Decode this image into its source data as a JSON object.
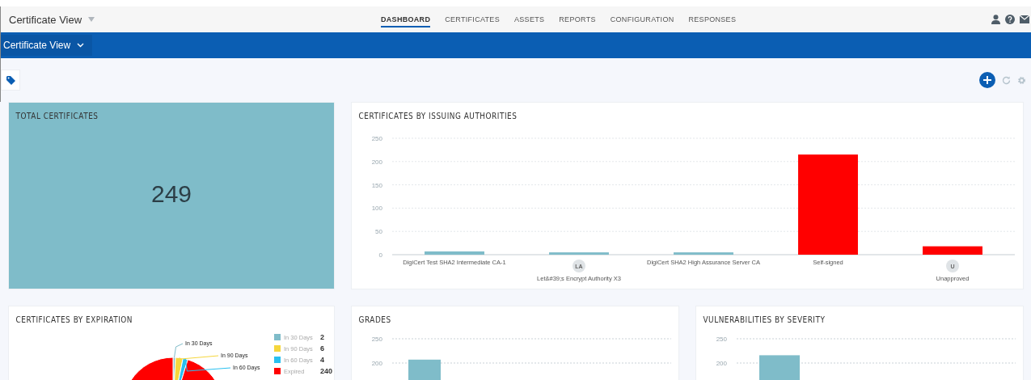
{
  "app_title": "Certificate View",
  "nav": [
    {
      "label": "DASHBOARD",
      "selected": true
    },
    {
      "label": "CERTIFICATES",
      "selected": false
    },
    {
      "label": "ASSETS",
      "selected": false
    },
    {
      "label": "REPORTS",
      "selected": false
    },
    {
      "label": "CONFIGURATION",
      "selected": false
    },
    {
      "label": "RESPONSES",
      "selected": false
    }
  ],
  "view_selector": "Certificate View",
  "total": {
    "title": "TOTAL CERTIFICATES",
    "value": "249"
  },
  "issuers": {
    "title": "CERTIFICATES BY ISSUING AUTHORITIES",
    "chart_data": {
      "type": "bar",
      "categories": [
        "DigiCert Test SHA2 Intermediate CA-1",
        "Let&#39;s Encrypt Authority X3",
        "DigiCert SHA2 High Assurance Server CA",
        "Self-signed",
        "Unapproved"
      ],
      "values": [
        7,
        5,
        5,
        215,
        18
      ],
      "colors": [
        "#7fbcc9",
        "#7fbcc9",
        "#7fbcc9",
        "#ff0000",
        "#ff0000"
      ],
      "grid": true,
      "ylim": [
        0,
        250
      ],
      "yticks": [
        0,
        50,
        100,
        150,
        200,
        250
      ]
    },
    "category_badges": [
      {
        "shown": false
      },
      {
        "shown": true,
        "text": "LA"
      },
      {
        "shown": false
      },
      {
        "shown": false
      },
      {
        "shown": true,
        "text": "U"
      }
    ]
  },
  "expiration": {
    "title": "CERTIFICATES BY EXPIRATION",
    "chart_data": {
      "type": "pie",
      "categories": [
        "In 30 Days",
        "In 90 Days",
        "In 60 Days",
        "Expired"
      ],
      "values": [
        2,
        6,
        4,
        240
      ],
      "colors": [
        "#7fbcc9",
        "#f5d63d",
        "#29c0f0",
        "#ff0000"
      ],
      "value_labels": [
        "2",
        "6",
        "4",
        "240"
      ],
      "annotations": [
        "In 30 Days",
        "In 90 Days",
        "In 60 Days"
      ],
      "legend": true
    }
  },
  "grades": {
    "title": "GRADES",
    "chart_data": {
      "type": "bar",
      "values": [
        207
      ],
      "color": "#7fbcc9",
      "grid": true,
      "ylim": [
        0,
        250
      ],
      "yticks": [
        200,
        250
      ]
    }
  },
  "vulnerabilities": {
    "title": "VULNERABILITIES BY SEVERITY",
    "chart_data": {
      "type": "bar",
      "values": [
        216
      ],
      "color": "#7fbcc9",
      "grid": true,
      "ylim": [
        0,
        250
      ],
      "yticks": [
        200,
        250
      ]
    }
  }
}
